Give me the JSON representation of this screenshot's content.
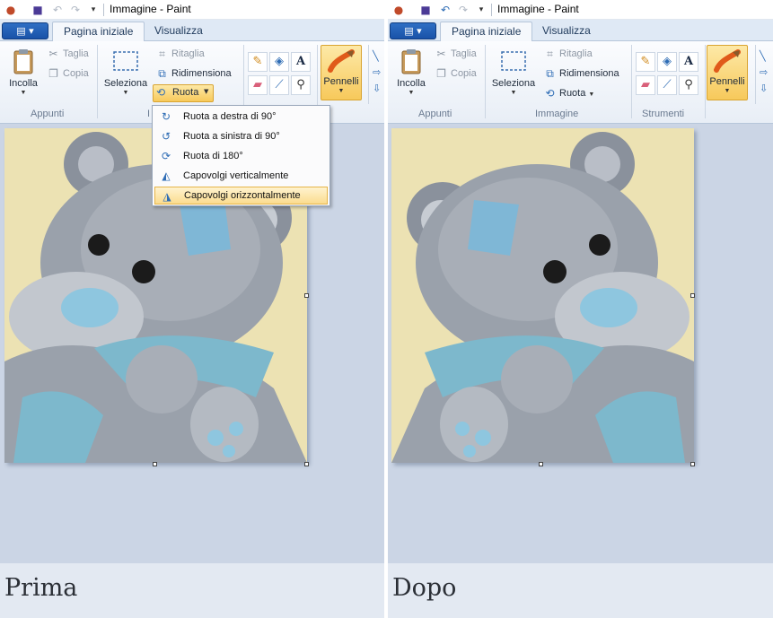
{
  "window": {
    "title": "Immagine - Paint"
  },
  "tabs": {
    "file_label": "▤ ▾",
    "home": "Pagina iniziale",
    "view": "Visualizza"
  },
  "clipboard": {
    "paste": "Incolla",
    "cut": "Taglia",
    "copy": "Copia",
    "group": "Appunti"
  },
  "image": {
    "select": "Seleziona",
    "crop": "Ritaglia",
    "resize": "Ridimensiona",
    "rotate": "Ruota",
    "group": "Immagine",
    "group_truncated": "I"
  },
  "tools": {
    "group": "Strumenti",
    "icons": [
      "pencil-icon",
      "fill-icon",
      "text-icon",
      "eraser-icon",
      "color-picker-icon",
      "magnifier-icon"
    ]
  },
  "brushes": {
    "label": "Pennelli"
  },
  "rotate_menu": {
    "items": [
      {
        "label": "Ruota a destra di 90°",
        "icon": "rotate-right-icon"
      },
      {
        "label": "Ruota a sinistra di 90°",
        "icon": "rotate-left-icon"
      },
      {
        "label": "Ruota di 180°",
        "icon": "rotate-180-icon"
      },
      {
        "label": "Capovolgi verticalmente",
        "icon": "flip-vertical-icon"
      },
      {
        "label": "Capovolgi orizzontalmente",
        "icon": "flip-horizontal-icon"
      }
    ],
    "highlighted_index": 4
  },
  "captions": {
    "before": "Prima",
    "after": "Dopo"
  },
  "colors": {
    "accent": "#f7c95b",
    "canvas_bg": "#cbd5e5",
    "caption_band": "#e3e9f2",
    "image_bg": "#ece2b3"
  }
}
